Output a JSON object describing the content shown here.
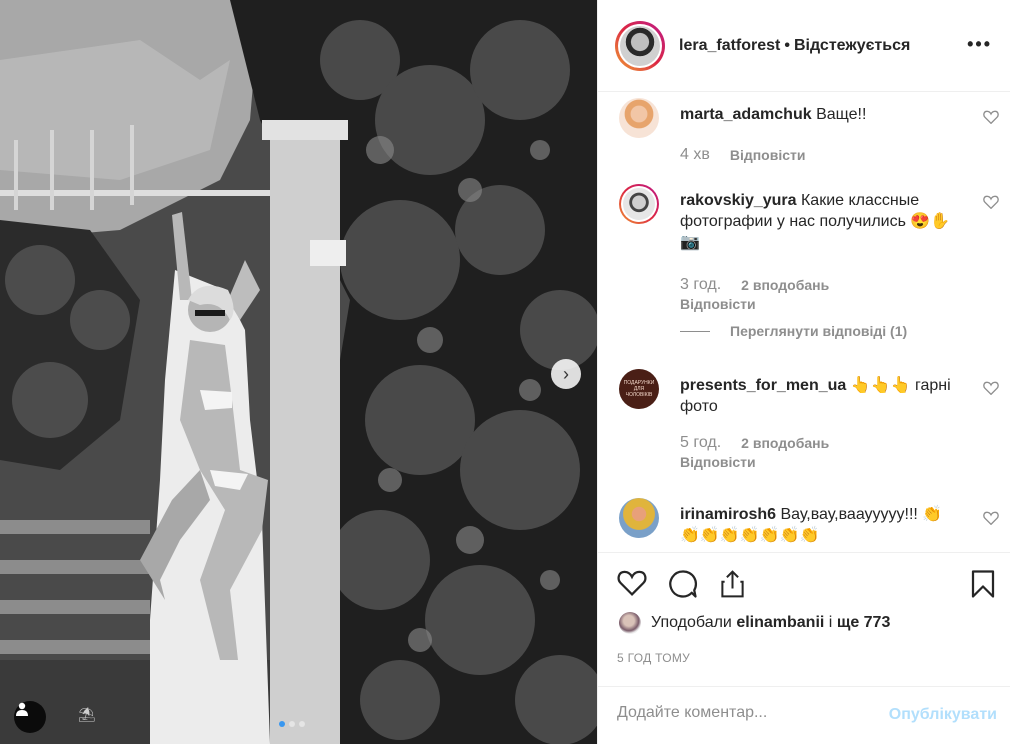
{
  "post": {
    "author": "lera_fatforest",
    "follow_status": "Відстежується",
    "more_label": "•••",
    "carousel_next": "›",
    "watermark": "⛱"
  },
  "comments": [
    {
      "user": "marta_adamchuk",
      "text": "Ваще!!",
      "time": "4 хв",
      "reply": "Відповісти"
    },
    {
      "user": "rakovskiy_yura",
      "text": "Какие классные фотографии у нас получились 😍✋📷",
      "time": "3 год.",
      "likes": "2 вподобань",
      "reply": "Відповісти",
      "view_replies": "Переглянути відповіді (1)"
    },
    {
      "user": "presents_for_men_ua",
      "text": "👆👆👆 гарні фото",
      "time": "5 год.",
      "likes": "2 вподобань",
      "reply": "Відповісти",
      "avatar_text": "ПОДАРУНКИ ДЛЯ ЧОЛОВІКІВ"
    },
    {
      "user": "irinamirosh6",
      "text": "Вау,вау,вааууууу!!! 👏👏👏👏👏👏👏👏",
      "time": "",
      "reply": ""
    }
  ],
  "likes": {
    "prefix": "Уподобали",
    "user": "elinambanii",
    "middle": "і",
    "rest": "ще 773"
  },
  "timestamp": "5 ГОД ТОМУ",
  "add_comment": {
    "placeholder": "Додайте коментар...",
    "post_label": "Опублікувати"
  },
  "colors": {
    "accent": "#3897f0",
    "post_disabled": "#b2dffc",
    "muted": "#8e8e8e"
  },
  "icons": [
    "heart-icon",
    "comment-icon",
    "share-icon",
    "bookmark-icon",
    "tag-user-icon",
    "chevron-right-icon",
    "more-icon"
  ]
}
